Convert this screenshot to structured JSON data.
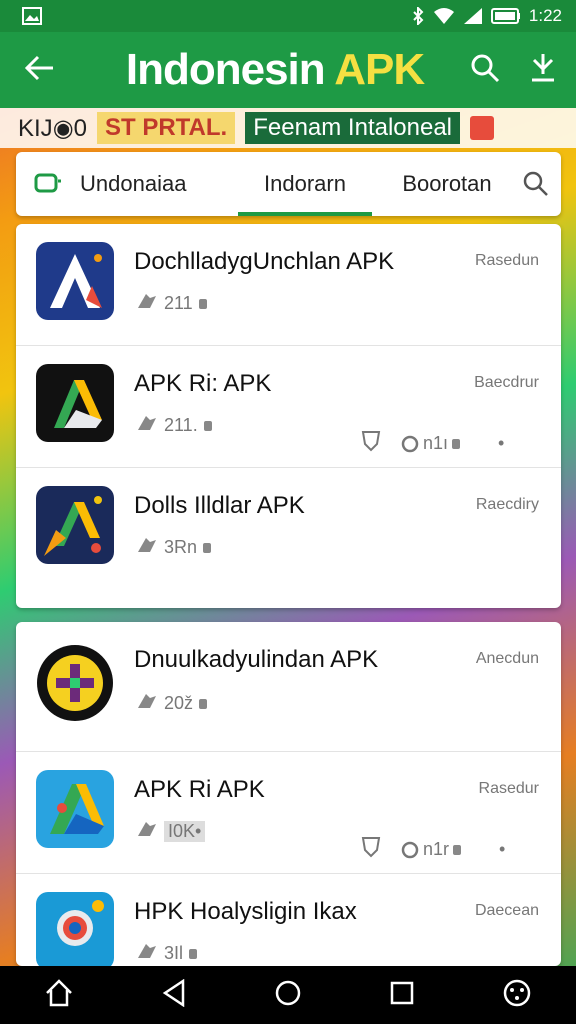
{
  "status_bar": {
    "time": "1:22",
    "icons": [
      "gallery-icon",
      "bluetooth-icon",
      "wifi-icon",
      "signal-icon",
      "battery-icon"
    ]
  },
  "app_bar": {
    "title_main": "Indonesin",
    "title_accent": "APK",
    "icons": [
      "back-arrow-icon",
      "search-icon",
      "download-icon"
    ],
    "accent_color": "#f5e042",
    "bg_color": "#1e9a45"
  },
  "banner": {
    "part1": "KIJ",
    "part1b": "0",
    "part2": "ST PRTAL.",
    "part3": "Feenam Intaloneal"
  },
  "tabs": [
    {
      "label": "Undonaiaa",
      "active": false
    },
    {
      "label": "Indorarn",
      "active": true
    },
    {
      "label": "Boorotan",
      "active": false
    }
  ],
  "cards": [
    {
      "apps": [
        {
          "name": "DochlladyɡUnchlan APK",
          "category": "Rasedun",
          "meta": "211",
          "extra": false
        },
        {
          "name": "APK Ri: APK",
          "category": "Baecdrur",
          "meta": "211.",
          "extra": true,
          "extra_text": "n1ı"
        },
        {
          "name": "Dolls Illdlar APK",
          "category": "Raecdiry",
          "meta": "3Rn",
          "extra": false
        }
      ]
    },
    {
      "apps": [
        {
          "name": "Dnuulkadyulindan APK",
          "category": "Anecdun",
          "meta": "20ž",
          "extra": false
        },
        {
          "name": "APK Ri APK",
          "category": "Rasedur",
          "meta": "I0K•",
          "extra": true,
          "extra_text": "n1r"
        },
        {
          "name": "HPK Hoalysligin Ikax",
          "category": "Daecean",
          "meta": "3Il",
          "extra": false
        }
      ]
    }
  ],
  "nav_bar": {
    "icons": [
      "home-icon",
      "back-icon",
      "circle-home-icon",
      "recents-icon",
      "assistant-icon"
    ]
  }
}
